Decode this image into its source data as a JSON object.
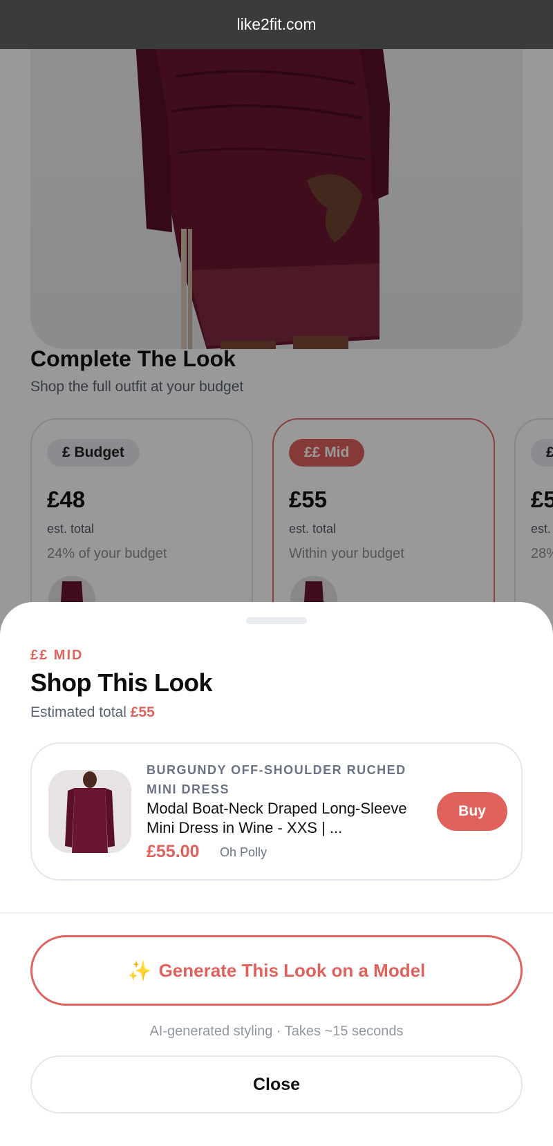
{
  "browser": {
    "url": "like2fit.com"
  },
  "background": {
    "section_title": "Complete The Look",
    "section_subtitle": "Shop the full outfit at your budget",
    "tiers": [
      {
        "label": "£ Budget",
        "price": "£48",
        "est_label": "est. total",
        "note": "24% of your budget",
        "selected": false
      },
      {
        "label": "££ Mid",
        "price": "£55",
        "est_label": "est. total",
        "note": "Within your budget",
        "selected": true
      },
      {
        "label": "£",
        "price": "£5",
        "est_label": "est.",
        "note": "28%",
        "selected": false
      }
    ]
  },
  "sheet": {
    "tier_label": "££ MID",
    "title": "Shop This Look",
    "total_prefix": "Estimated total",
    "total_amount": "£55",
    "product": {
      "category": "BURGUNDY OFF-SHOULDER RUCHED MINI DRESS",
      "name": "Modal Boat-Neck Draped Long-Sleeve Mini Dress in Wine - XXS | ...",
      "price": "£55.00",
      "brand": "Oh Polly",
      "buy_label": "Buy"
    },
    "generate_label": "Generate This Look on a Model",
    "generate_icon": "sparkles-icon",
    "generate_note": "AI-generated styling · Takes ~15 seconds",
    "close_label": "Close"
  },
  "colors": {
    "accent": "#e0625d",
    "dress": "#6b1630",
    "url_bar": "#3a3b3d"
  }
}
